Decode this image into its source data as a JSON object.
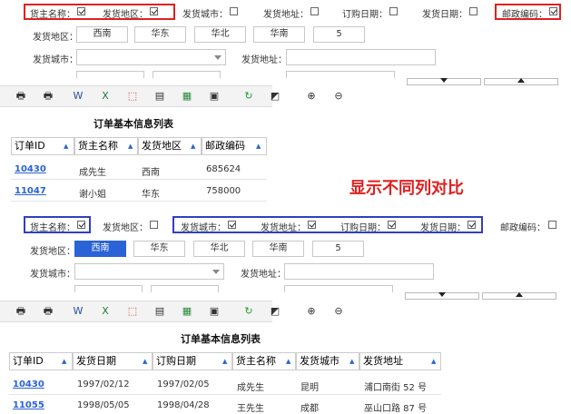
{
  "top": {
    "checks": [
      {
        "label": "货主名称：",
        "checked": true
      },
      {
        "label": "发货地区：",
        "checked": true
      },
      {
        "label": "发货城市：",
        "checked": false
      },
      {
        "label": "发货地址：",
        "checked": false
      },
      {
        "label": "订购日期：",
        "checked": false
      },
      {
        "label": "发货日期：",
        "checked": false
      },
      {
        "label": "邮政编码：",
        "checked": true
      }
    ],
    "region_label": "发货地区：",
    "regions": [
      "西南",
      "华东",
      "华北",
      "华南",
      "5"
    ],
    "city_label": "发货城市：",
    "address_label": "发货地址：",
    "table_title": "订单基本信息列表",
    "headers": [
      "订单ID",
      "货主名称",
      "发货地区",
      "邮政编码"
    ],
    "rows": [
      [
        "10430",
        "成先生",
        "西南",
        "685624"
      ],
      [
        "11047",
        "谢小姐",
        "华东",
        "758000"
      ]
    ]
  },
  "compare_label": "显示不同列对比",
  "bottom": {
    "checks": [
      {
        "label": "货主名称：",
        "checked": true
      },
      {
        "label": "发货地区：",
        "checked": false
      },
      {
        "label": "发货城市：",
        "checked": true
      },
      {
        "label": "发货地址：",
        "checked": true
      },
      {
        "label": "订购日期：",
        "checked": true
      },
      {
        "label": "发货日期：",
        "checked": true
      },
      {
        "label": "邮政编码：",
        "checked": false
      }
    ],
    "region_label": "发货地区：",
    "regions": [
      "西南",
      "华东",
      "华北",
      "华南",
      "5"
    ],
    "city_label": "发货城市：",
    "address_label": "发货地址：",
    "table_title": "订单基本信息列表",
    "headers": [
      "订单ID",
      "发货日期",
      "订购日期",
      "货主名称",
      "发货城市",
      "发货地址"
    ],
    "rows": [
      [
        "10430",
        "1997/02/12",
        "1997/02/05",
        "成先生",
        "昆明",
        "浦口南街 52 号"
      ],
      [
        "11055",
        "1998/05/05",
        "1998/04/28",
        "王先生",
        "成都",
        "巫山口路 87 号"
      ]
    ]
  },
  "colors": {
    "highlight_red": "#e02020",
    "highlight_blue": "#3040c0",
    "selected": "#2a63d6",
    "link": "#2a63d6"
  },
  "toolbar_icons": [
    "print-icon",
    "print-preview-icon",
    "word-export-icon",
    "excel-export-icon",
    "pdf-export-icon",
    "text-export-icon",
    "image-export-icon",
    "page-setup-icon",
    "refresh-icon",
    "rss-icon",
    "zoom-in-icon",
    "zoom-out-icon"
  ]
}
